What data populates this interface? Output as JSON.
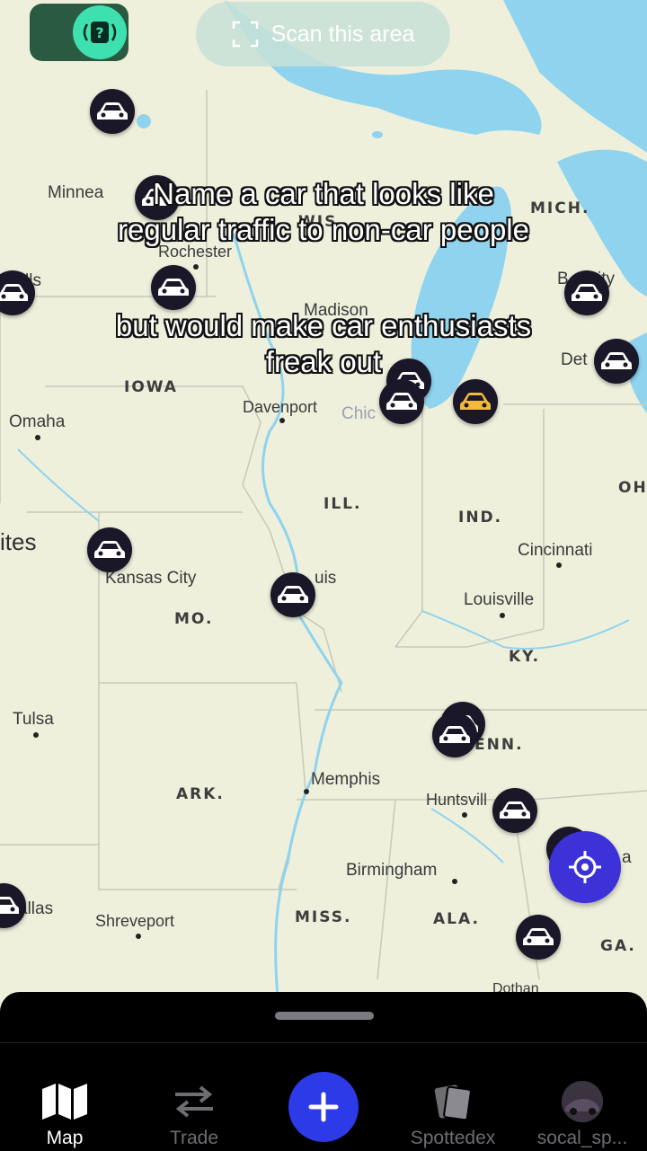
{
  "toggle": {
    "icon": "question-radio-icon",
    "accent": "#3fe0b0"
  },
  "scan": {
    "label": "Scan this area",
    "icon": "scan-frame-icon"
  },
  "caption": {
    "line1": "Name a car that looks like",
    "line2": "regular traffic to non-car people",
    "line3": "but would make car enthusiasts",
    "line4": "freak out"
  },
  "map": {
    "cities": [
      {
        "name": "Minnea"
      },
      {
        "name": "Rochester"
      },
      {
        "name": "lls"
      },
      {
        "name": "Madison"
      },
      {
        "name": "Davenport"
      },
      {
        "name": "Chic"
      },
      {
        "name": "Omaha"
      },
      {
        "name": "Kansas City"
      },
      {
        "name": "uis"
      },
      {
        "name": "Cincinnati"
      },
      {
        "name": "Louisville"
      },
      {
        "name": "Tulsa"
      },
      {
        "name": "Memphis"
      },
      {
        "name": "Huntsvill"
      },
      {
        "name": "Birmingham"
      },
      {
        "name": "Shreveport"
      },
      {
        "name": "allas"
      },
      {
        "name": "Det"
      },
      {
        "name": "ity"
      },
      {
        "name": "ites"
      },
      {
        "name": "Dothan"
      },
      {
        "name": "a"
      },
      {
        "name": "B"
      }
    ],
    "states": [
      "IOWA",
      "ILL.",
      "IND.",
      "MO.",
      "KY.",
      "ENN.",
      "ARK.",
      "MISS.",
      "ALA.",
      "GA.",
      "MICH.",
      "OH",
      "WIS"
    ]
  },
  "tabs": [
    {
      "label": "Map",
      "icon": "map-icon"
    },
    {
      "label": "Trade",
      "icon": "swap-arrows-icon"
    },
    {
      "label": "",
      "icon": "plus-icon"
    },
    {
      "label": "Spottedex",
      "icon": "cards-icon"
    },
    {
      "label": "socal_sp...",
      "icon": "avatar"
    }
  ],
  "colors": {
    "water": "#8fd3ee",
    "land": "#eef0dc",
    "accent": "#2c3ae8",
    "locate": "#3c32d8"
  }
}
